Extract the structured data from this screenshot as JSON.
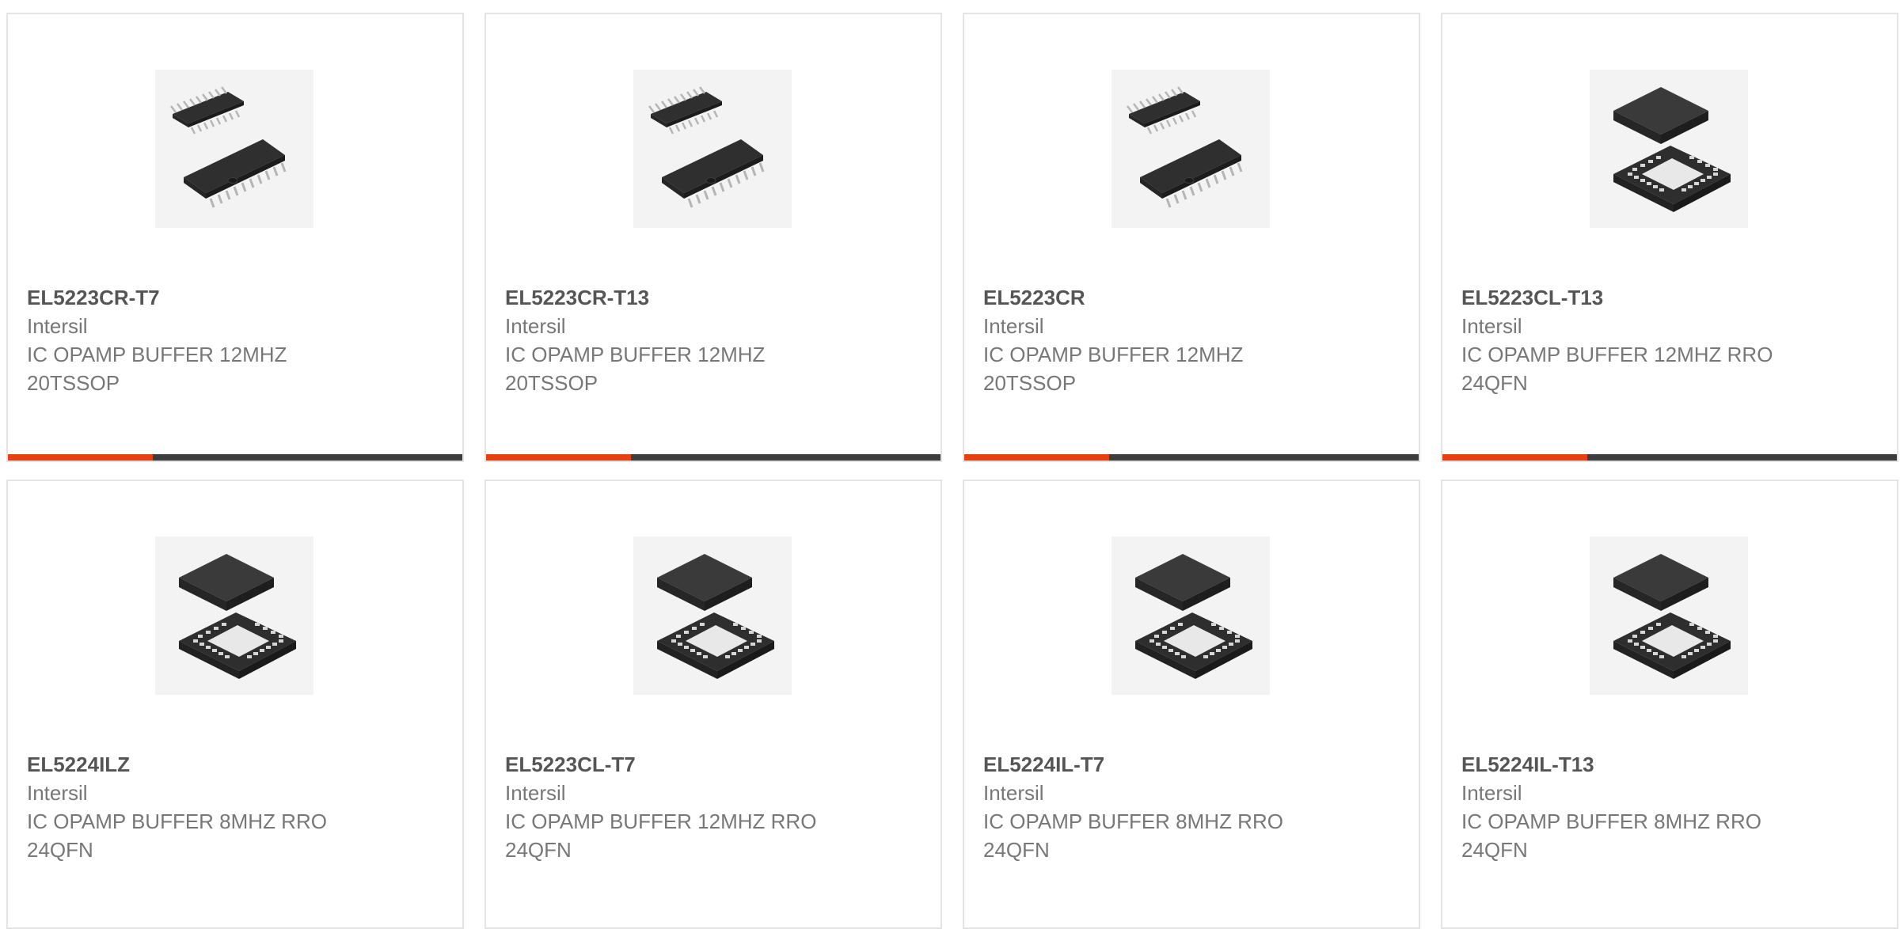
{
  "colors": {
    "accent": "#e8400f",
    "bar": "#3d3d3d",
    "title": "#555555",
    "text": "#777777",
    "border": "#e4e4e4"
  },
  "products": [
    {
      "part_number": "EL5223CR-T7",
      "manufacturer": "Intersil",
      "description": "IC OPAMP BUFFER 12MHZ 20TSSOP",
      "package_icon": "tssop-package-icon"
    },
    {
      "part_number": "EL5223CR-T13",
      "manufacturer": "Intersil",
      "description": "IC OPAMP BUFFER 12MHZ 20TSSOP",
      "package_icon": "tssop-package-icon"
    },
    {
      "part_number": "EL5223CR",
      "manufacturer": "Intersil",
      "description": "IC OPAMP BUFFER 12MHZ 20TSSOP",
      "package_icon": "tssop-package-icon"
    },
    {
      "part_number": "EL5223CL-T13",
      "manufacturer": "Intersil",
      "description": "IC OPAMP BUFFER 12MHZ RRO 24QFN",
      "package_icon": "qfn-package-icon"
    },
    {
      "part_number": "EL5224ILZ",
      "manufacturer": "Intersil",
      "description": "IC OPAMP BUFFER 8MHZ RRO 24QFN",
      "package_icon": "qfn-package-icon"
    },
    {
      "part_number": "EL5223CL-T7",
      "manufacturer": "Intersil",
      "description": "IC OPAMP BUFFER 12MHZ RRO 24QFN",
      "package_icon": "qfn-package-icon"
    },
    {
      "part_number": "EL5224IL-T7",
      "manufacturer": "Intersil",
      "description": "IC OPAMP BUFFER 8MHZ RRO 24QFN",
      "package_icon": "qfn-package-icon"
    },
    {
      "part_number": "EL5224IL-T13",
      "manufacturer": "Intersil",
      "description": "IC OPAMP BUFFER 8MHZ RRO 24QFN",
      "package_icon": "qfn-package-icon"
    }
  ]
}
